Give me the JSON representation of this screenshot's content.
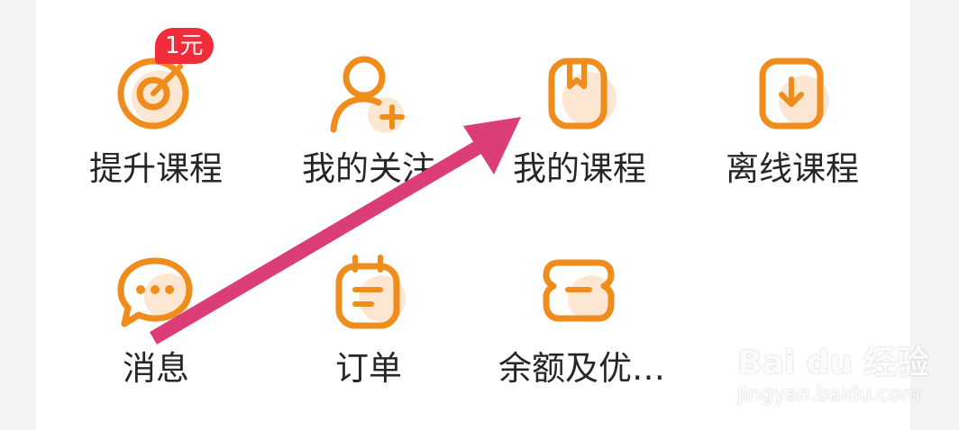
{
  "colors": {
    "accent": "#f08c1b",
    "accent_soft": "#fde7d2",
    "badge": "#f22d3b",
    "annotation_arrow": "#db3e77"
  },
  "menu": {
    "row1": [
      {
        "label": "提升课程",
        "icon": "target-icon",
        "badge": "1元"
      },
      {
        "label": "我的关注",
        "icon": "user-add-icon"
      },
      {
        "label": "我的课程",
        "icon": "book-icon"
      },
      {
        "label": "离线课程",
        "icon": "download-icon"
      }
    ],
    "row2": [
      {
        "label": "消息",
        "icon": "chat-bubble-icon"
      },
      {
        "label": "订单",
        "icon": "calendar-list-icon"
      },
      {
        "label": "余额及优…",
        "icon": "wallet-icon"
      }
    ]
  },
  "watermark": {
    "logo_text": "Bai du 经验",
    "url": "jingyan.baidu.com"
  }
}
